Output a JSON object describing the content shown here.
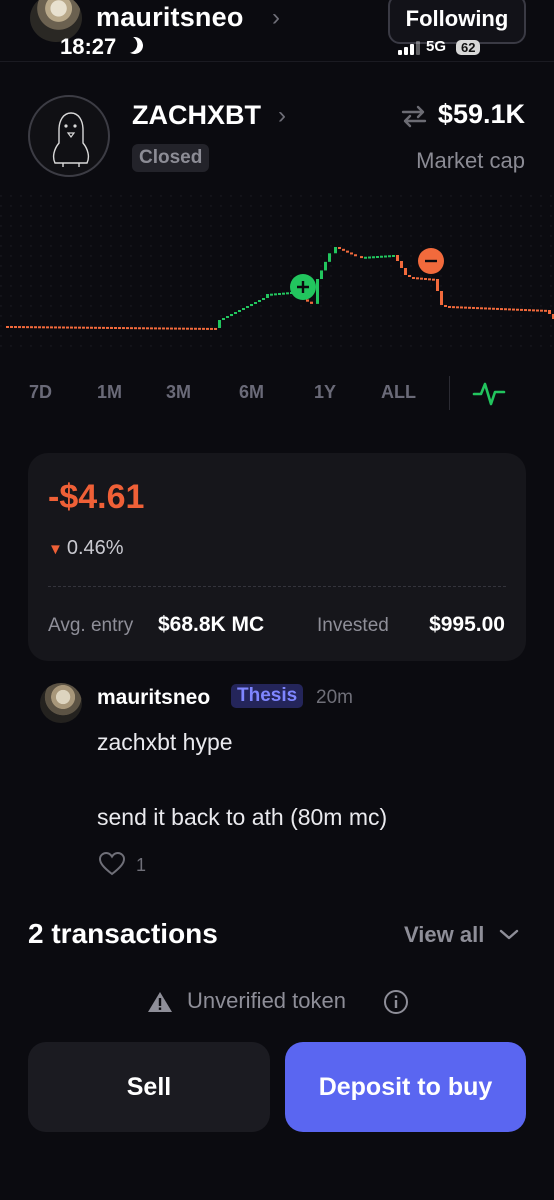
{
  "header": {
    "username": "mauritsneo",
    "time": "18:27",
    "follow_label": "Following",
    "network": "5G",
    "battery": "62"
  },
  "token": {
    "name": "ZACHXBT",
    "status_badge": "Closed",
    "market_cap_value": "$59.1K",
    "market_cap_label": "Market cap"
  },
  "ranges": [
    "7D",
    "1M",
    "3M",
    "6M",
    "1Y",
    "ALL"
  ],
  "position": {
    "pnl": "-$4.61",
    "pnl_pct": "0.46%",
    "avg_entry_label": "Avg. entry",
    "avg_entry_value": "$68.8K MC",
    "invested_label": "Invested",
    "invested_value": "$995.00"
  },
  "comment": {
    "user": "mauritsneo",
    "tag": "Thesis",
    "time": "20m",
    "line1": "zachxbt hype",
    "line2": "send it back to ath (80m mc)",
    "likes": "1"
  },
  "transactions": {
    "title": "2 transactions",
    "view_all": "View all"
  },
  "warning": "Unverified token",
  "actions": {
    "sell": "Sell",
    "deposit": "Deposit to buy"
  },
  "colors": {
    "up": "#22c55e",
    "down": "#f26a3c",
    "accent": "#5a66f1"
  },
  "icons": {
    "buy_marker": "plus-marker-icon",
    "sell_marker": "minus-marker-icon",
    "chart_type": "pulse-line-icon"
  }
}
